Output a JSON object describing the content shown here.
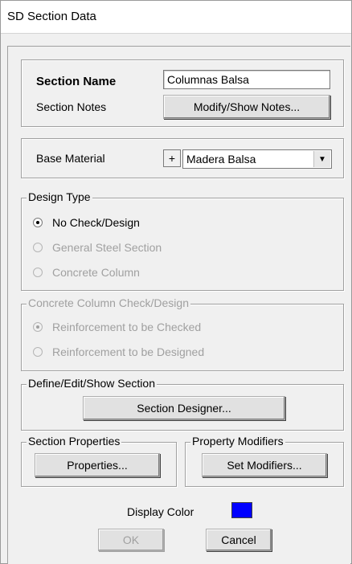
{
  "window": {
    "title": "SD Section Data"
  },
  "section": {
    "name_label": "Section Name",
    "name_value": "Columnas Balsa",
    "notes_label": "Section Notes",
    "notes_button": "Modify/Show Notes..."
  },
  "material": {
    "label": "Base Material",
    "plus": "+",
    "value": "Madera Balsa",
    "arrow": "▼"
  },
  "design_type": {
    "legend": "Design Type",
    "options": [
      "No Check/Design",
      "General Steel Section",
      "Concrete Column"
    ],
    "selected": "No Check/Design"
  },
  "concrete_check": {
    "legend": "Concrete Column Check/Design",
    "options": [
      "Reinforcement to be Checked",
      "Reinforcement to be Designed"
    ],
    "selected": "Reinforcement to be Checked"
  },
  "define": {
    "legend": "Define/Edit/Show Section",
    "button": "Section Designer..."
  },
  "properties": {
    "legend": "Section Properties",
    "button": "Properties..."
  },
  "modifiers": {
    "legend": "Property Modifiers",
    "button": "Set Modifiers..."
  },
  "display_color": {
    "label": "Display Color",
    "color": "#0000ff"
  },
  "footer": {
    "ok": "OK",
    "cancel": "Cancel"
  }
}
